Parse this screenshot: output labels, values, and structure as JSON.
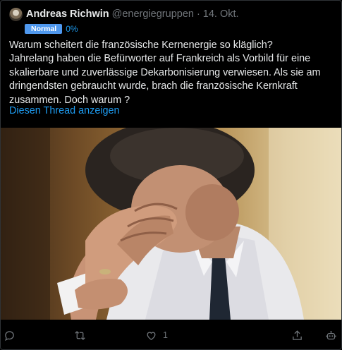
{
  "tweet": {
    "author_name": "Andreas Richwin",
    "handle": "@energiegruppen",
    "separator": "·",
    "date": "14. Okt.",
    "badge": "Normal",
    "badge_pct": "0%",
    "text_lines": [
      "Warum scheitert die französische Kernenergie so kläglich?",
      "Jahrelang haben die Befürworter auf Frankreich als Vorbild für eine",
      "skalierbare und zuverlässige Dekarbonisierung verwiesen. Als sie am",
      "dringendsten gebraucht wurde, brach die französische Kernkraft",
      "zusammen. Doch warum ?"
    ],
    "thread_link": "Diesen Thread anzeigen"
  },
  "actions": {
    "reply_count": "",
    "retweet_count": "",
    "like_count": "1",
    "share_icon": "share-icon",
    "bot_icon": "bot-icon"
  },
  "colors": {
    "background": "#000000",
    "text": "#e7e9ea",
    "muted": "#71767b",
    "link": "#1d9bf0",
    "badge": "#4f98ee"
  }
}
